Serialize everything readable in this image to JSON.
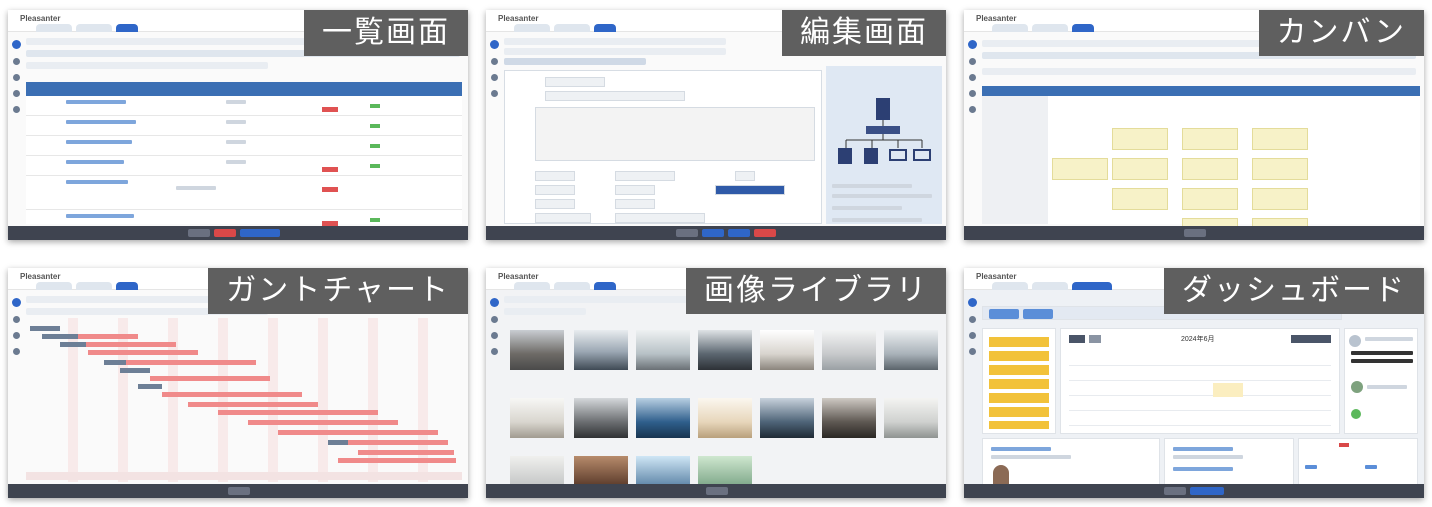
{
  "app": {
    "logo_text": "Pleasanter"
  },
  "panels": [
    {
      "id": "list",
      "label": "一覧画面"
    },
    {
      "id": "edit",
      "label": "編集画面"
    },
    {
      "id": "kanban",
      "label": "カンバン"
    },
    {
      "id": "gantt",
      "label": "ガントチャート"
    },
    {
      "id": "library",
      "label": "画像ライブラリ"
    },
    {
      "id": "dashboard",
      "label": "ダッシュボード"
    }
  ],
  "dashboard": {
    "calendar_title": "2024年6月"
  },
  "colors": {
    "label_bg": "#5f5f5f",
    "accent": "#2f66c8",
    "footer": "#3f4450",
    "kanban_card": "#f7f2c8",
    "gantt_bar": "#f08a8a",
    "dash_yellow": "#f2c23a"
  }
}
